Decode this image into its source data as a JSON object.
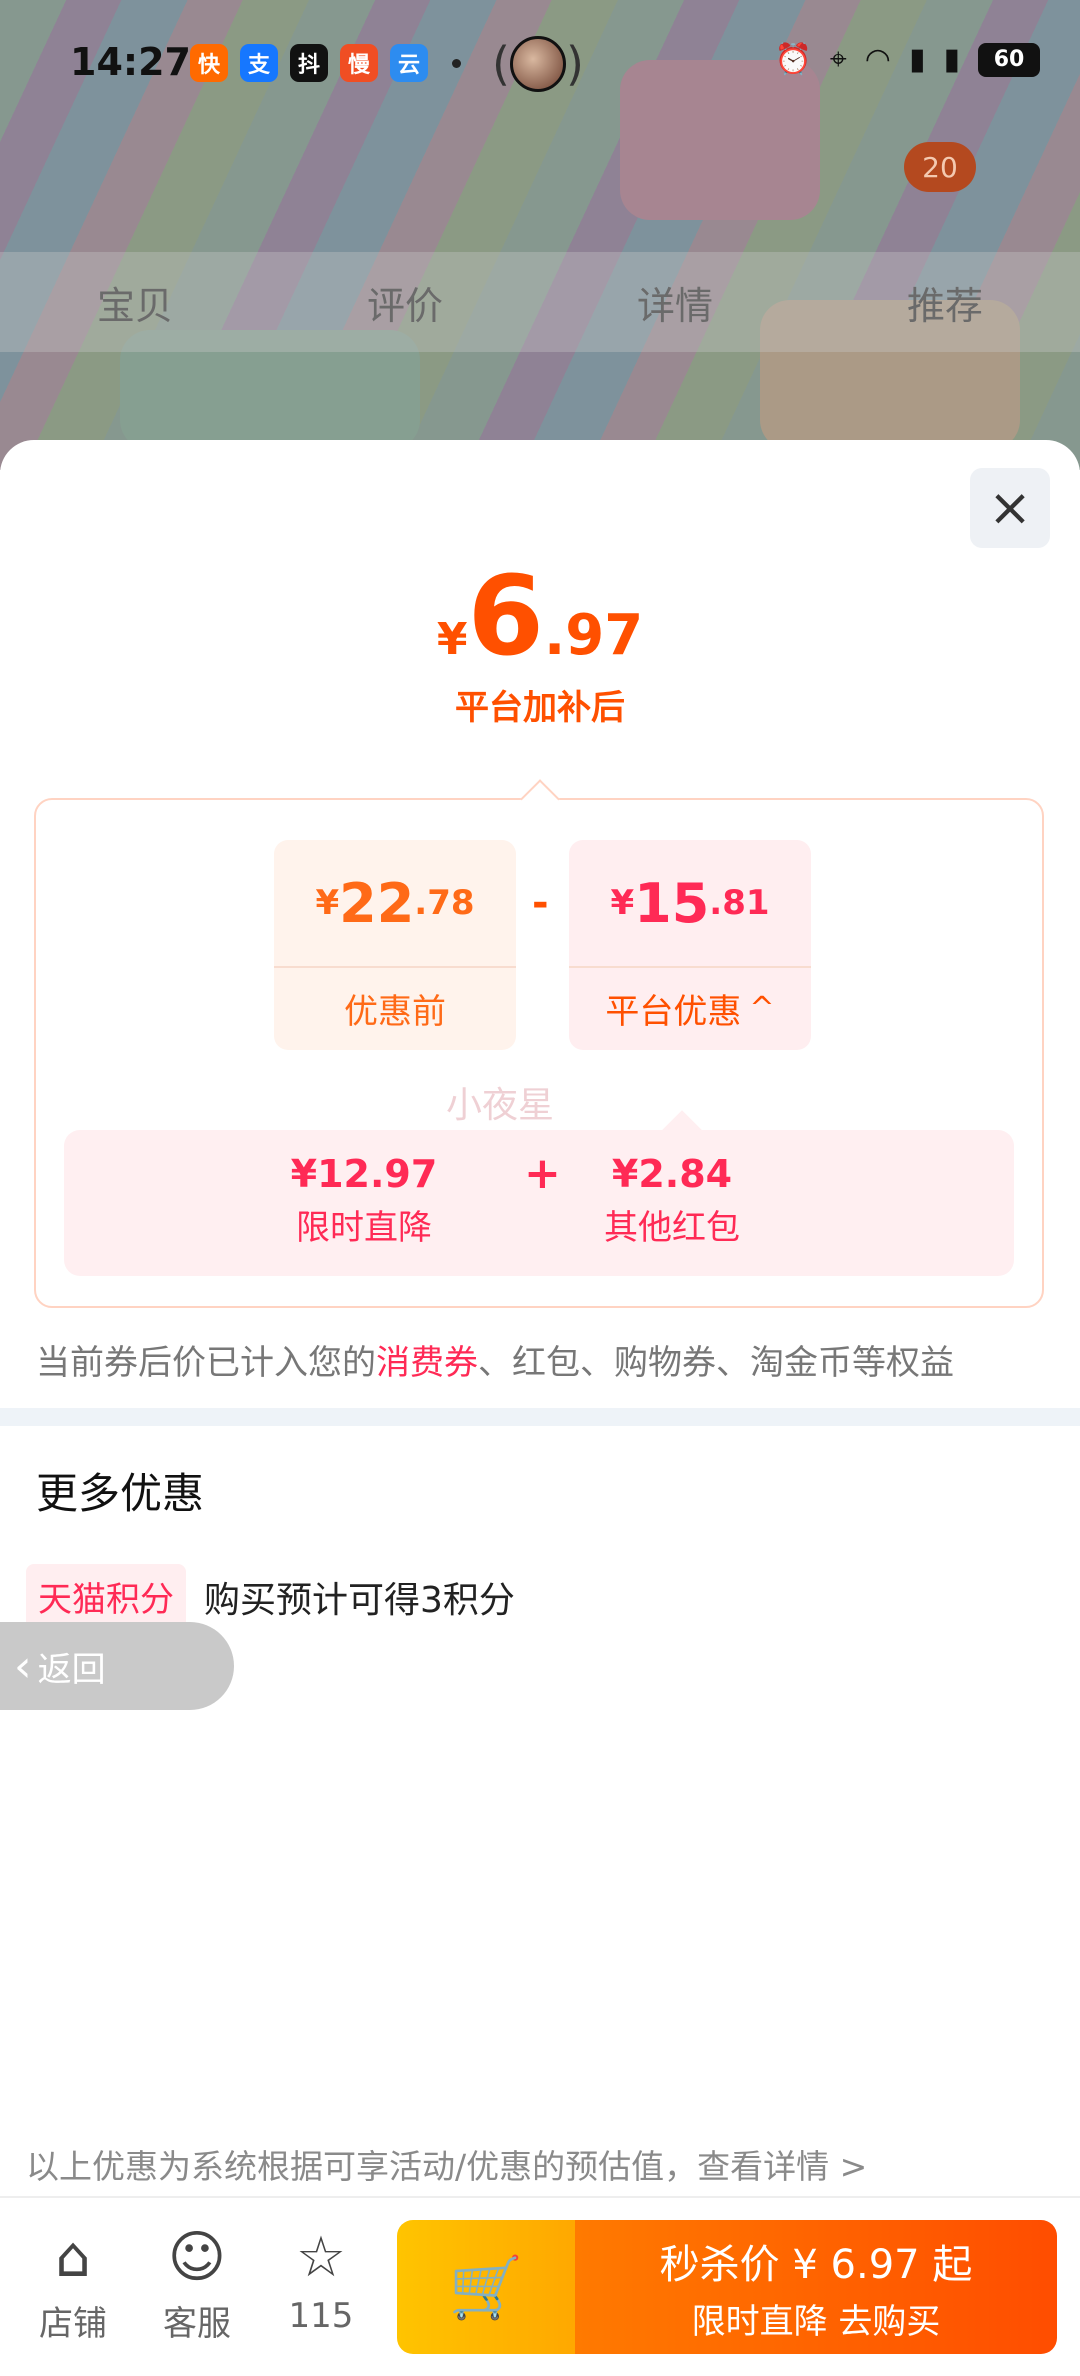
{
  "status_bar": {
    "time": "14:27",
    "battery": "60",
    "app_icons": [
      "快",
      "支",
      "抖",
      "慢",
      "云"
    ]
  },
  "background": {
    "cart_badge": "20",
    "tabs": [
      "宝贝",
      "评价",
      "详情",
      "推荐"
    ]
  },
  "sheet": {
    "close_label": "×",
    "final_price": {
      "currency": "¥",
      "integer": "6",
      "decimal": ".97"
    },
    "final_price_label": "平台加补后",
    "before_card": {
      "currency": "¥",
      "integer": "22",
      "decimal": ".78",
      "label": "优惠前"
    },
    "minus_sign": "-",
    "platform_card": {
      "currency": "¥",
      "integer": "15",
      "decimal": ".81",
      "label": "平台优惠",
      "chevron": "^"
    },
    "details": [
      {
        "value": "¥12.97",
        "label": "限时直降"
      },
      {
        "value": "¥2.84",
        "label": "其他红包"
      }
    ],
    "plus_sign": "+",
    "watermark": "小夜星",
    "note_prefix": "当前券后价已计入您的",
    "note_highlight": "消费券",
    "note_suffix": "、红包、购物券、淘金币等权益",
    "more_title": "更多优惠",
    "tag_label": "天猫积分",
    "tag_text": "购买预计可得3积分",
    "back_label": "返回",
    "footnote": "以上优惠为系统根据可享活动/优惠的预估值，查看详情 >"
  },
  "action_bar": {
    "store_label": "店铺",
    "service_label": "客服",
    "favorite_count": "115",
    "buy_line1": "秒杀价 ¥ 6.97 起",
    "buy_line2": "限时直降  去购买"
  },
  "colors": {
    "accent": "#ff5000",
    "red": "#ff2a55"
  }
}
